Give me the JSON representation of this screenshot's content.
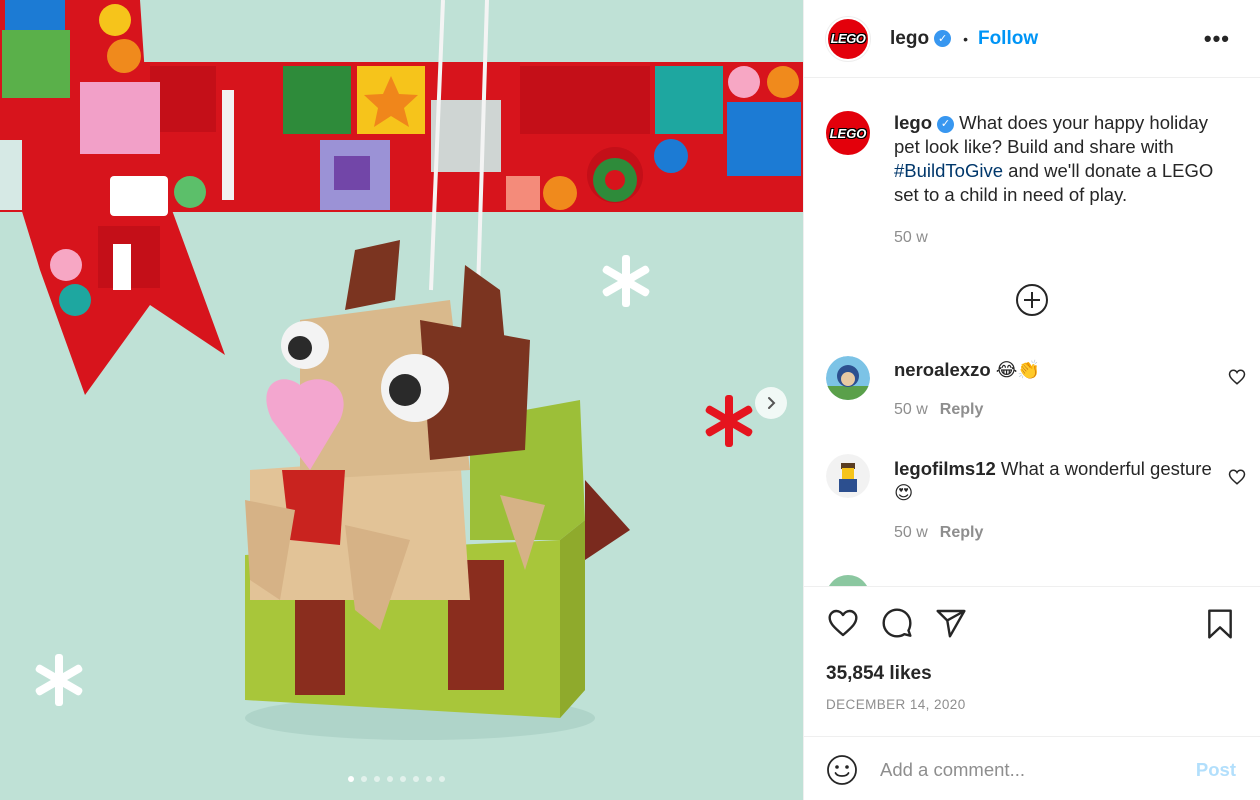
{
  "media": {
    "image_alt": "",
    "carousel_total": 8,
    "carousel_active": 1,
    "next_icon": "chevron-right-icon"
  },
  "header": {
    "username": "lego",
    "logo_text": "LEGO",
    "separator": "•",
    "follow_label": "Follow",
    "more_icon": "more-horizontal-icon",
    "more_label": "•••"
  },
  "caption": {
    "username": "lego",
    "text_before": " What does your happy holiday pet look like? Build and share with ",
    "hashtag": "#BuildToGive",
    "text_after": " and we'll donate a LEGO set to a child in need of play.",
    "time": "50 w"
  },
  "comments": [
    {
      "username": "neroalexzo",
      "text": " 😂👏",
      "time": "50 w",
      "reply_label": "Reply"
    },
    {
      "username": "legofilms12",
      "text": " What a wonderful gesture😍",
      "time": "50 w",
      "reply_label": "Reply"
    }
  ],
  "actions": {
    "likes": "35,854 likes",
    "date": "DECEMBER 14, 2020"
  },
  "comment_box": {
    "placeholder": "Add a comment...",
    "post_label": "Post"
  },
  "colors": {
    "accent": "#0095f6",
    "brand_red": "#e3000b",
    "background_mint": "#bfe1d6"
  }
}
